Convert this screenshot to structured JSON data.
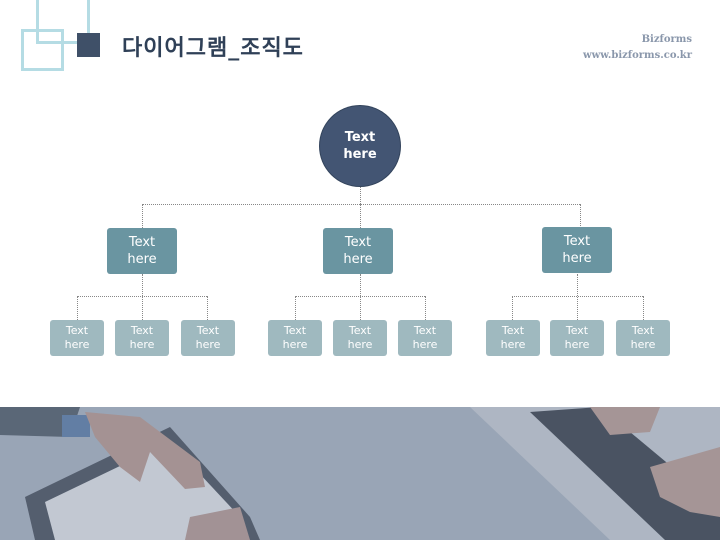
{
  "header": {
    "title": "다이어그램_조직도",
    "brand_name": "Bizforms",
    "brand_url": "www.bizforms.co.kr"
  },
  "icons": {
    "logo": "overlapping-squares-logo"
  },
  "colors": {
    "root_node": "#435573",
    "level1_node": "#6a95a1",
    "level2_node": "#9fb9bf",
    "logo_outline": "#b5dce4",
    "logo_accent": "#3f5068"
  },
  "org_chart": {
    "root": {
      "label": "Text\nhere"
    },
    "branches": [
      {
        "label": "Text\nhere",
        "children": [
          {
            "label": "Text\nhere"
          },
          {
            "label": "Text\nhere"
          },
          {
            "label": "Text\nhere"
          }
        ]
      },
      {
        "label": "Text\nhere",
        "children": [
          {
            "label": "Text\nhere"
          },
          {
            "label": "Text\nhere"
          },
          {
            "label": "Text\nhere"
          }
        ]
      },
      {
        "label": "Text\nhere",
        "children": [
          {
            "label": "Text\nhere"
          },
          {
            "label": "Text\nhere"
          },
          {
            "label": "Text\nhere"
          }
        ]
      }
    ]
  },
  "footer_image": {
    "description": "business hands writing in notebook and typing on laptop"
  }
}
